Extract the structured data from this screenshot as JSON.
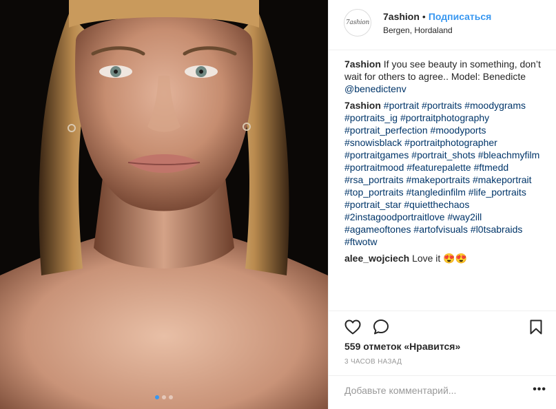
{
  "header": {
    "avatar_text": "7ashion",
    "username": "7ashion",
    "separator": "•",
    "follow_label": "Подписаться",
    "location": "Bergen, Hordaland"
  },
  "caption": {
    "author": "7ashion",
    "text": "If you see beauty in something, don’t wait for others to agree.. Model: Benedicte",
    "mention": "@benedictenv"
  },
  "hashtags_comment": {
    "author": "7ashion",
    "tags": [
      "#portrait",
      "#portraits",
      "#moodygrams",
      "#portraits_ig",
      "#portraitphotography",
      "#portrait_perfection",
      "#moodyports",
      "#snowisblack",
      "#portraitphotographer",
      "#portraitgames",
      "#portrait_shots",
      "#bleachmyfilm",
      "#portraitmood",
      "#featurepalette",
      "#ftmedd",
      "#rsa_portraits",
      "#makeportraits",
      "#makeportrait",
      "#top_portraits",
      "#tangledinfilm",
      "#life_portraits",
      "#portrait_star",
      "#quietthechaos",
      "#2instagoodportraitlove",
      "#way2ill",
      "#agameoftones",
      "#artofvisuals",
      "#l0tsabraids",
      "#ftwotw"
    ]
  },
  "user_comment": {
    "author": "alee_wojciech",
    "text": "Love it",
    "emoji": "😍😍"
  },
  "actions": {
    "like_icon": "heart-icon",
    "comment_icon": "speech-bubble-icon",
    "save_icon": "bookmark-icon"
  },
  "likes_text": "559 отметок «Нравится»",
  "time_text": "3 часов назад",
  "add_comment": {
    "placeholder": "Добавьте комментарий...",
    "more_label": "•••"
  },
  "carousel": {
    "count": 3,
    "active_index": 0
  },
  "colors": {
    "link": "#003569",
    "accent": "#3897f0",
    "text": "#262626",
    "muted": "#999999",
    "border": "#efefef"
  }
}
